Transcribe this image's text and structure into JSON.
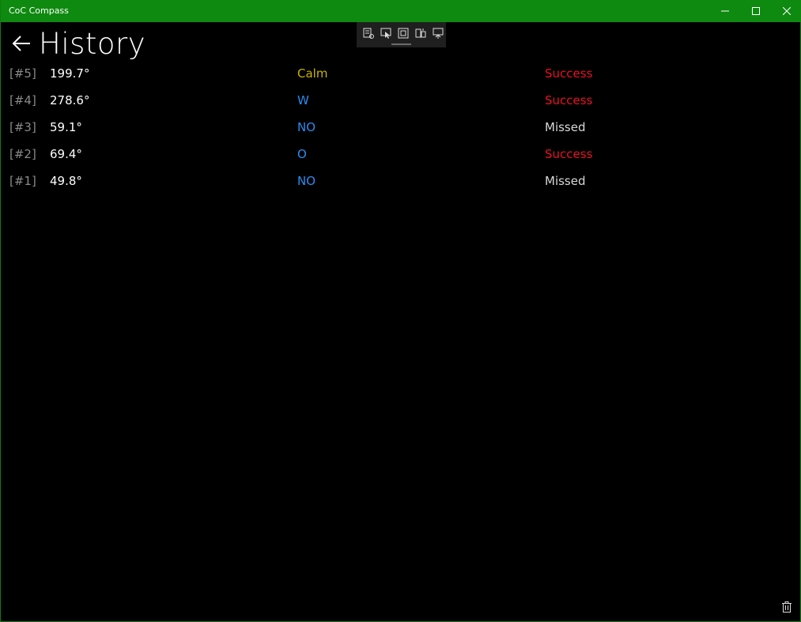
{
  "window": {
    "title": "CoC Compass"
  },
  "page": {
    "title": "History"
  },
  "history": [
    {
      "index": "[#5]",
      "angle": "199.7°",
      "wind": "Calm",
      "wind_color": "#c8b400",
      "result": "Success",
      "result_color": "#e81123"
    },
    {
      "index": "[#4]",
      "angle": "278.6°",
      "wind": "W",
      "wind_color": "#2b8cf0",
      "result": "Success",
      "result_color": "#e81123"
    },
    {
      "index": "[#3]",
      "angle": "59.1°",
      "wind": "NO",
      "wind_color": "#2b8cf0",
      "result": "Missed",
      "result_color": "#d8d8d8"
    },
    {
      "index": "[#2]",
      "angle": "69.4°",
      "wind": "O",
      "wind_color": "#2b8cf0",
      "result": "Success",
      "result_color": "#e81123"
    },
    {
      "index": "[#1]",
      "angle": "49.8°",
      "wind": "NO",
      "wind_color": "#2b8cf0",
      "result": "Missed",
      "result_color": "#d8d8d8"
    }
  ],
  "colors": {
    "titlebar": "#0f8a10",
    "background": "#000000"
  },
  "icons": {
    "back": "back-arrow-icon",
    "clear": "trash-icon"
  }
}
